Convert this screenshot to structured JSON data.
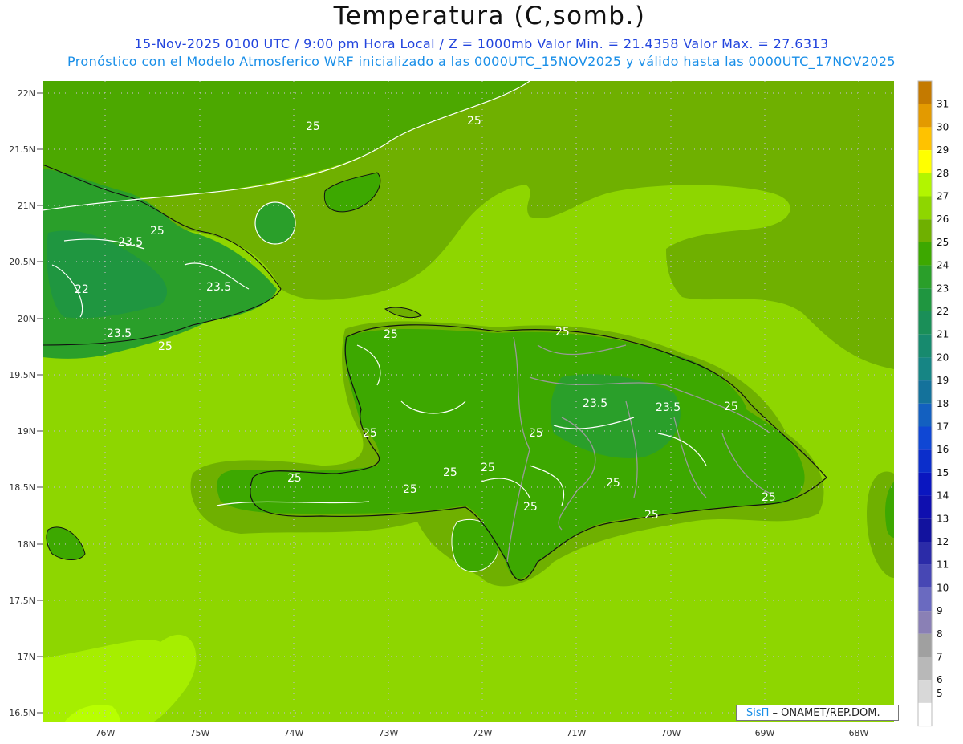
{
  "title": "Temperatura (C,somb.)",
  "subtitle_1": "15-Nov-2025  0100 UTC / 9:00 pm Hora Local / Z = 1000mb   Valor Min. = 21.4358  Valor Max. = 27.6313",
  "subtitle_2": "Pronóstico con el Modelo Atmosferico WRF inicializado a las 0000UTC_15NOV2025 y válido hasta las  0000UTC_17NOV2025",
  "lat_labels": [
    "22N",
    "21.5N",
    "21N",
    "20.5N",
    "20N",
    "19.5N",
    "19N",
    "18.5N",
    "18N",
    "17.5N",
    "17N",
    "16.5N"
  ],
  "lon_labels": [
    "76W",
    "75W",
    "74W",
    "73W",
    "72W",
    "71W",
    "70W",
    "69W",
    "68W"
  ],
  "colorbar": {
    "labels": [
      "31",
      "30",
      "29",
      "28",
      "27",
      "26",
      "25",
      "24",
      "23",
      "22",
      "21",
      "20",
      "19",
      "18",
      "17",
      "16",
      "15",
      "14",
      "13",
      "12",
      "11",
      "10",
      "9",
      "8",
      "7",
      "6",
      "5"
    ],
    "colors": [
      "#c47a00",
      "#e39a00",
      "#ffc200",
      "#ffff00",
      "#b2f500",
      "#8ed600",
      "#6fb000",
      "#3da800",
      "#2a9f2a",
      "#1f9640",
      "#1a8f58",
      "#178a6e",
      "#168584",
      "#14729b",
      "#1360c0",
      "#0f47d4",
      "#0b2ecb",
      "#0a16c0",
      "#0f0faf",
      "#12129e",
      "#2b2ba8",
      "#4747b4",
      "#6a6ac0",
      "#8a80b5",
      "#a0a0a0",
      "#b8b8b8",
      "#d8d8d8",
      "#ffffff"
    ]
  },
  "contour_labels": [
    "25",
    "25",
    "25",
    "23.5",
    "22",
    "23.5",
    "23.5",
    "25",
    "25",
    "25",
    "23.5",
    "23.5",
    "25",
    "25",
    "25",
    "25",
    "25",
    "25",
    "25",
    "25",
    "25",
    "25",
    "25"
  ],
  "credit": {
    "brand": "SisΠ",
    "text": " – ONAMET/REP.DOM."
  }
}
